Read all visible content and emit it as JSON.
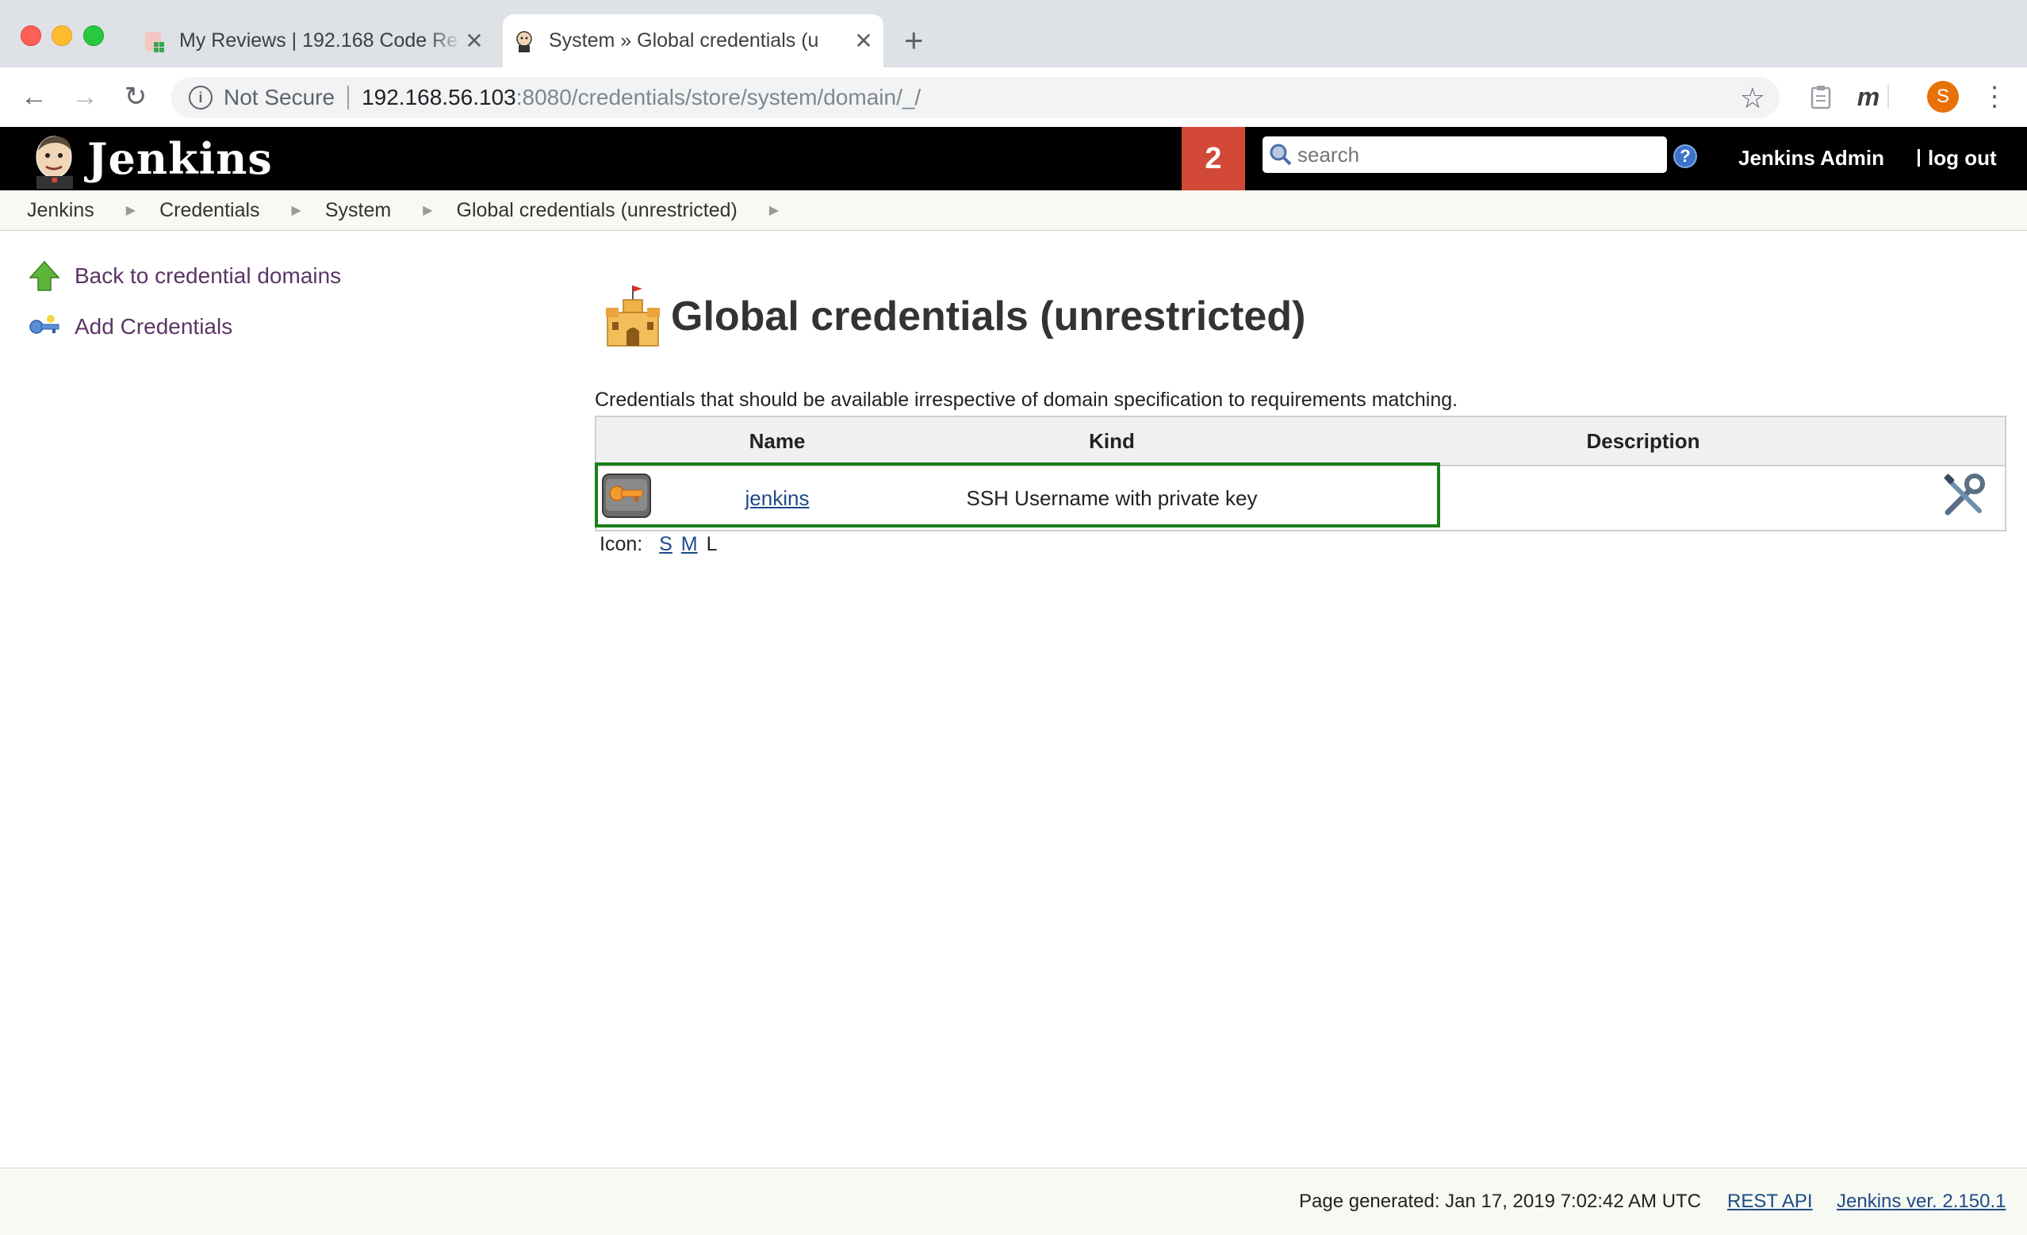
{
  "browser": {
    "tabs": [
      {
        "title": "My Reviews | 192.168 Code Re",
        "active": false
      },
      {
        "title": "System » Global credentials (u",
        "active": true
      }
    ],
    "security_label": "Not Secure",
    "url_host": "192.168.56.103",
    "url_path": ":8080/credentials/store/system/domain/_/",
    "profile_initial": "S",
    "extension_m": "m"
  },
  "header": {
    "app_name": "Jenkins",
    "notification_count": "2",
    "search_placeholder": "search",
    "help": "?",
    "user_name": "Jenkins Admin",
    "logout": "log out"
  },
  "breadcrumbs": [
    "Jenkins",
    "Credentials",
    "System",
    "Global credentials (unrestricted)"
  ],
  "sidepanel": {
    "back_link": "Back to credential domains",
    "add_link": "Add Credentials"
  },
  "main": {
    "title": "Global credentials (unrestricted)",
    "description": "Credentials that should be available irrespective of domain specification to requirements matching.",
    "table": {
      "headers": [
        "Name",
        "Kind",
        "Description"
      ],
      "rows": [
        {
          "name": "jenkins",
          "kind": "SSH Username with private key",
          "description": ""
        }
      ]
    },
    "icon_size_label": "Icon:",
    "icon_sizes": [
      "S",
      "M",
      "L"
    ]
  },
  "footer": {
    "generated": "Page generated: Jan 17, 2019 7:02:42 AM UTC",
    "rest_api": "REST API",
    "version": "Jenkins ver. 2.150.1"
  },
  "colors": {
    "header_bg": "#000000",
    "badge": "#d24939",
    "highlight_border": "#1a7f1a",
    "link": "#204a87",
    "side_link": "#5c3566"
  }
}
